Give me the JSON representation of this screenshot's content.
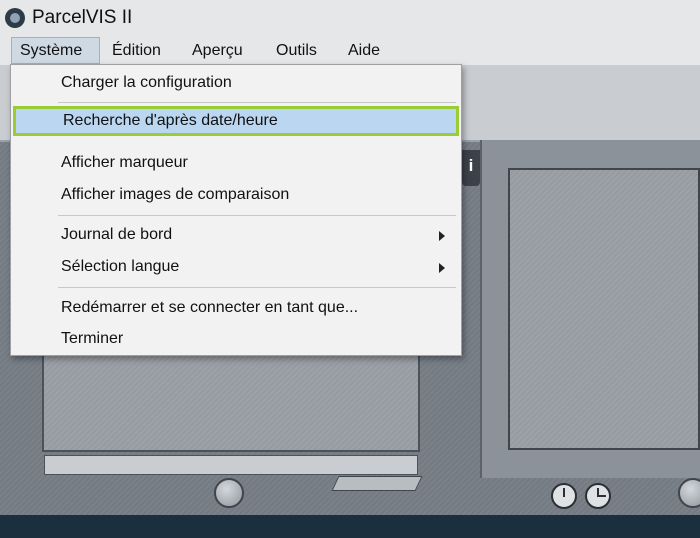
{
  "app": {
    "title": "ParcelVIS II"
  },
  "menubar": {
    "items": [
      {
        "label": "Système"
      },
      {
        "label": "Édition"
      },
      {
        "label": "Aperçu"
      },
      {
        "label": "Outils"
      },
      {
        "label": "Aide"
      }
    ]
  },
  "dropdown": {
    "items": [
      {
        "label": "Charger la configuration"
      },
      {
        "label": "Recherche d'après date/heure",
        "highlighted": true
      },
      {
        "label": "Afficher marqueur"
      },
      {
        "label": "Afficher images de comparaison"
      },
      {
        "label": "Journal de bord",
        "submenu": true
      },
      {
        "label": "Sélection langue",
        "submenu": true
      },
      {
        "label": "Redémarrer et se connecter en tant que..."
      },
      {
        "label": "Terminer"
      }
    ]
  },
  "workspace": {
    "info_tab_label": "i"
  },
  "colors": {
    "highlight_fill": "#bad6f0",
    "highlight_border": "#9ccc33",
    "bottom_bar": "#1c2f3e"
  }
}
